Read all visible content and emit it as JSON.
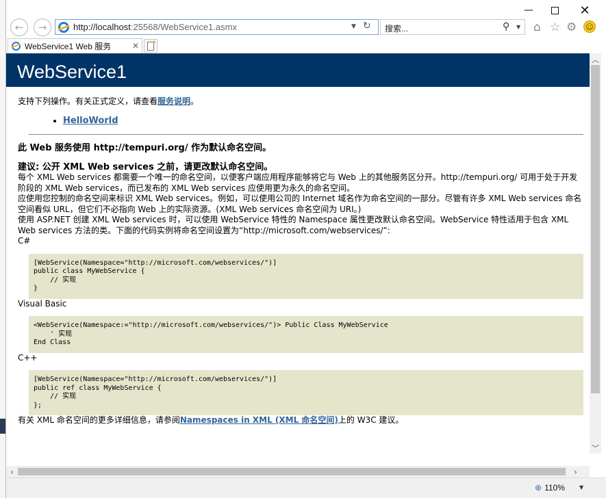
{
  "window": {
    "minimize_glyph": "—",
    "close_glyph": "✕"
  },
  "nav": {
    "back_glyph": "←",
    "forward_glyph": "→",
    "address_host": "http://localhost",
    "address_rest": ":25568/WebService1.asmx",
    "search_placeholder": "搜索..."
  },
  "tab": {
    "title": "WebService1 Web 服务"
  },
  "page": {
    "title": "WebService1",
    "intro_prefix": "支持下列操作。有关正式定义，请查看",
    "intro_link": "服务说明",
    "intro_suffix": "。",
    "operations": [
      "HelloWorld"
    ],
    "namespace_heading": "此 Web 服务使用 http://tempuri.org/ 作为默认命名空间。",
    "recommend_heading": "建议: 公开 XML Web services 之前，请更改默认命名空间。",
    "para1": "每个 XML Web services 都需要一个唯一的命名空间，以便客户端应用程序能够将它与 Web 上的其他服务区分开。http://tempuri.org/ 可用于处于开发阶段的 XML Web services，而已发布的 XML Web services 应使用更为永久的命名空间。",
    "para2": "应使用您控制的命名空间来标识 XML Web services。例如，可以使用公司的 Internet 域名作为命名空间的一部分。尽管有许多 XML Web services 命名空间看似 URL，但它们不必指向 Web 上的实际资源。(XML Web services 命名空间为 URI。)",
    "para3": "使用 ASP.NET 创建 XML Web services 时，可以使用 WebService 特性的 Namespace 属性更改默认命名空间。WebService 特性适用于包含 XML Web services 方法的类。下面的代码实例将命名空间设置为“http://microsoft.com/webservices/”:",
    "csharp_label": "C#",
    "csharp_code": "[WebService(Namespace=\"http://microsoft.com/webservices/\")]\npublic class MyWebService {\n    // 实现\n}",
    "vb_label": "Visual Basic",
    "vb_code": "<WebService(Namespace:=\"http://microsoft.com/webservices/\")> Public Class MyWebService\n    ' 实现\nEnd Class",
    "cpp_label": "C++",
    "cpp_code": "[WebService(Namespace=\"http://microsoft.com/webservices/\")]\npublic ref class MyWebService {\n    // 实现\n};",
    "footer_prefix": "有关 XML 命名空间的更多详细信息，请参阅",
    "footer_link": "Namespaces in XML (XML 命名空间)",
    "footer_suffix": "上的 W3C 建议。"
  },
  "status": {
    "zoom": "110%"
  },
  "colors": {
    "heading_bar": "#003366",
    "link": "#336699",
    "code_bg": "#e5e5cc"
  }
}
